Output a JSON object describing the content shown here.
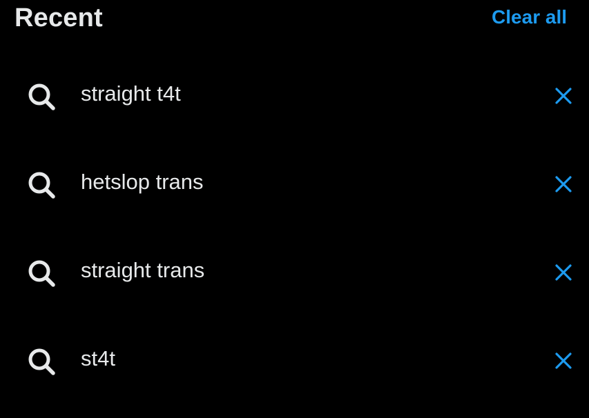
{
  "header": {
    "title": "Recent",
    "clear_all_label": "Clear all"
  },
  "recent_searches": [
    {
      "query": "straight t4t",
      "icon": "search-icon",
      "remove_icon": "close-icon"
    },
    {
      "query": "hetslop trans",
      "icon": "search-icon",
      "remove_icon": "close-icon"
    },
    {
      "query": "straight trans",
      "icon": "search-icon",
      "remove_icon": "close-icon"
    },
    {
      "query": "st4t",
      "icon": "search-icon",
      "remove_icon": "close-icon"
    }
  ],
  "colors": {
    "background": "#000000",
    "text": "#e7e9ea",
    "accent": "#1d9bf0"
  }
}
